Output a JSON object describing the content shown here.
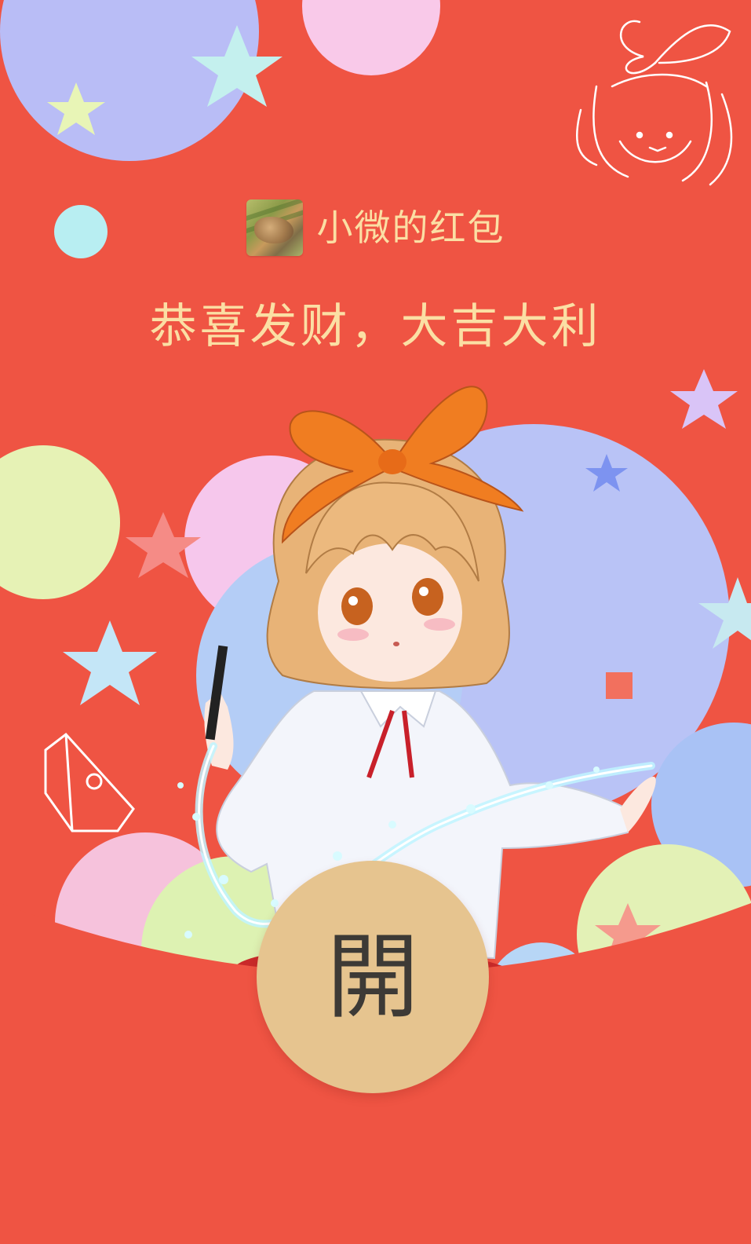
{
  "envelope": {
    "sender_name": "小微的红包",
    "greeting": "恭喜发财，大吉大利",
    "open_label": "開",
    "avatar_icon": "cat-photo-avatar"
  },
  "colors": {
    "background": "#ef5443",
    "text_gold": "#fbdfa4",
    "open_button": "#e6c48f",
    "open_label": "#3d3a36"
  }
}
